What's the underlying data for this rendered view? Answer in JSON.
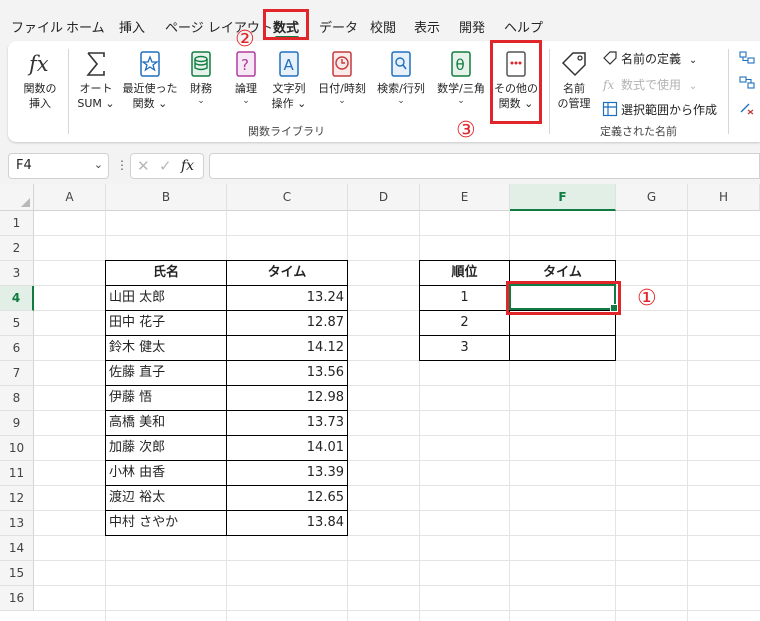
{
  "menu": {
    "tabs": [
      {
        "label": "ファイル"
      },
      {
        "label": "ホーム"
      },
      {
        "label": "挿入"
      },
      {
        "label": "ページ レイアウト"
      },
      {
        "label": "数式"
      },
      {
        "label": "データ"
      },
      {
        "label": "校閲"
      },
      {
        "label": "表示"
      },
      {
        "label": "開発"
      },
      {
        "label": "ヘルプ"
      }
    ],
    "active_tab": "数式"
  },
  "ribbon": {
    "function_library": {
      "group_label": "関数ライブラリ",
      "insert_function": {
        "line1": "関数の",
        "line2": "挿入"
      },
      "autosum": {
        "line1": "オート",
        "line2": "SUM"
      },
      "recent": {
        "line1": "最近使った",
        "line2": "関数"
      },
      "financial": {
        "line1": "財務"
      },
      "logical": {
        "line1": "論理"
      },
      "text": {
        "line1": "文字列",
        "line2": "操作"
      },
      "datetime": {
        "line1": "日付/時刻"
      },
      "lookup": {
        "line1": "検索/行列"
      },
      "math": {
        "line1": "数学/三角"
      },
      "more": {
        "line1": "その他の",
        "line2": "関数"
      }
    },
    "defined_names": {
      "group_label": "定義された名前",
      "name_manager": {
        "line1": "名前",
        "line2": "の管理"
      },
      "define_name": "名前の定義",
      "use_in_formula": "数式で使用",
      "create_from_selection": "選択範囲から作成"
    }
  },
  "formula_bar": {
    "name_box": "F4",
    "dots": "⋮",
    "fx_label": "fx",
    "formula": ""
  },
  "sheet": {
    "columns": [
      "A",
      "B",
      "C",
      "D",
      "E",
      "F",
      "G",
      "H"
    ],
    "rows": [
      "1",
      "2",
      "3",
      "4",
      "5",
      "6",
      "7",
      "8",
      "9",
      "10",
      "11",
      "12",
      "13",
      "14",
      "15",
      "16"
    ],
    "selected_cell": "F4",
    "table1": {
      "headers": [
        "氏名",
        "タイム"
      ],
      "rows": [
        [
          "山田 太郎",
          "13.24"
        ],
        [
          "田中 花子",
          "12.87"
        ],
        [
          "鈴木 健太",
          "14.12"
        ],
        [
          "佐藤 直子",
          "13.56"
        ],
        [
          "伊藤 悟",
          "12.98"
        ],
        [
          "高橋 美和",
          "13.73"
        ],
        [
          "加藤 次郎",
          "14.01"
        ],
        [
          "小林 由香",
          "13.39"
        ],
        [
          "渡辺 裕太",
          "12.65"
        ],
        [
          "中村 さやか",
          "13.84"
        ]
      ]
    },
    "table2": {
      "headers": [
        "順位",
        "タイム"
      ],
      "rows": [
        [
          "1",
          ""
        ],
        [
          "2",
          ""
        ],
        [
          "3",
          ""
        ]
      ]
    }
  },
  "annotations": {
    "one": "①",
    "two": "②",
    "three": "③",
    "color": "#e0262b"
  },
  "colors": {
    "excel_green": "#107c41",
    "annotation_red": "#e0262b"
  }
}
